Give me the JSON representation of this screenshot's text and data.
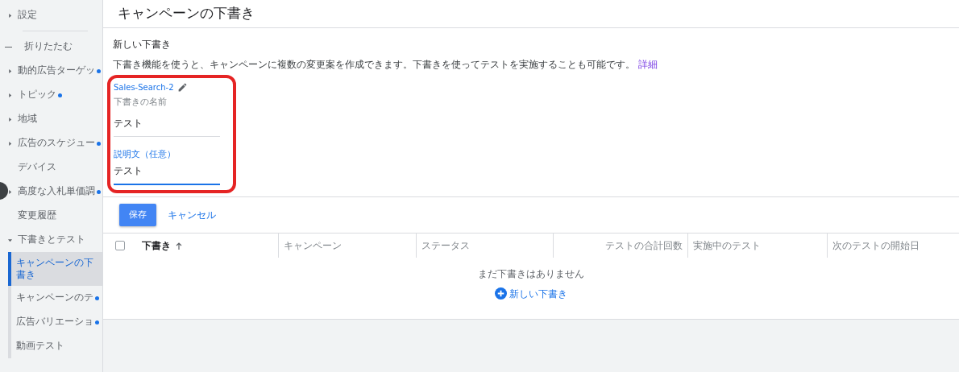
{
  "sidebar": {
    "items": [
      {
        "kind": "group",
        "label": "設定",
        "expanded": false,
        "changed": false
      },
      {
        "kind": "divider"
      },
      {
        "kind": "collapse",
        "label": "折りたたむ"
      },
      {
        "kind": "group",
        "label": "動的広告ターゲッ",
        "expanded": false,
        "changed": true
      },
      {
        "kind": "group",
        "label": "トピック",
        "expanded": false,
        "changed": true
      },
      {
        "kind": "group",
        "label": "地域",
        "expanded": false,
        "changed": false
      },
      {
        "kind": "group",
        "label": "広告のスケジュー",
        "expanded": false,
        "changed": true
      },
      {
        "kind": "link",
        "label": "デバイス",
        "changed": false
      },
      {
        "kind": "group",
        "label": "高度な入札単価調",
        "expanded": false,
        "changed": true
      },
      {
        "kind": "link",
        "label": "変更履歴",
        "changed": false
      },
      {
        "kind": "group",
        "label": "下書きとテスト",
        "expanded": true,
        "changed": false,
        "children": [
          {
            "label": "キャンペーンの下書き",
            "selected": true,
            "changed": false
          },
          {
            "label": "キャンペーンのテ",
            "selected": false,
            "changed": true
          },
          {
            "label": "広告バリエーショ",
            "selected": false,
            "changed": true
          },
          {
            "label": "動画テスト",
            "selected": false,
            "changed": false
          }
        ]
      }
    ]
  },
  "page_title": "キャンペーンの下書き",
  "form": {
    "heading": "新しい下書き",
    "description": "下書き機能を使うと、キャンペーンに複数の変更案を作成できます。下書きを使ってテストを実施することも可能です。",
    "details_link": "詳細",
    "draft_name": "Sales-Search-2",
    "fields": [
      {
        "label": "下書きの名前",
        "value": "テスト",
        "focused": false
      },
      {
        "label": "説明文（任意）",
        "value": "テスト",
        "focused": true
      }
    ],
    "highlighted": true
  },
  "buttons": {
    "save": "保存",
    "cancel": "キャンセル"
  },
  "table": {
    "select_all": false,
    "columns": [
      {
        "label": "下書き",
        "sorted": true
      },
      {
        "label": "キャンペーン",
        "sorted": false
      },
      {
        "label": "ステータス",
        "sorted": false
      },
      {
        "label": "テストの合計回数",
        "sorted": false
      },
      {
        "label": "実施中のテスト",
        "sorted": false
      },
      {
        "label": "次のテストの開始日",
        "sorted": false
      }
    ],
    "empty_message": "まだ下書きはありません",
    "new_draft": "新しい下書き"
  }
}
